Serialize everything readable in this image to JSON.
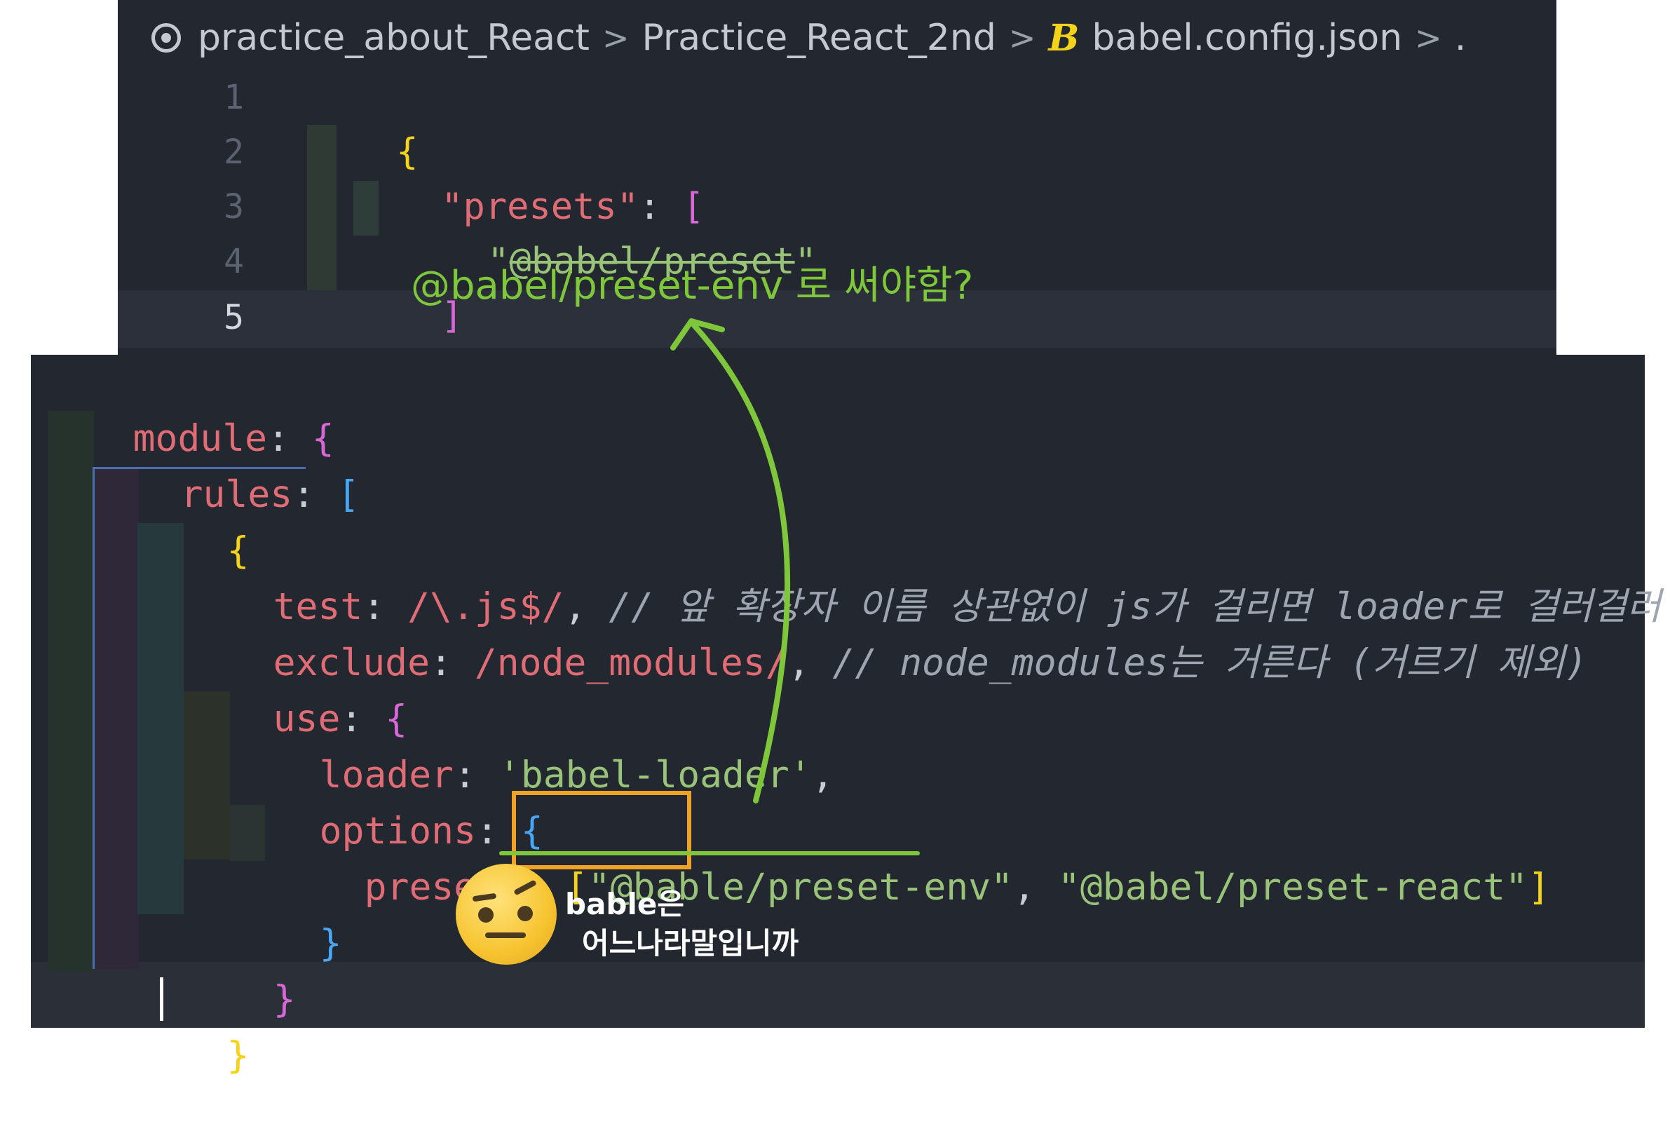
{
  "breadcrumb": {
    "items": [
      "practice_about_React",
      "Practice_React_2nd",
      "babel.config.json"
    ],
    "separator": ">",
    "trail": "."
  },
  "top_editor": {
    "line_numbers": [
      "1",
      "2",
      "3",
      "4",
      "5"
    ],
    "active_line": "5",
    "lines": {
      "l1_open": "{",
      "l2_key": "\"presets\"",
      "l2_colon": ": ",
      "l2_bracket": "[",
      "l3_q_open": "\"",
      "l3_value": "@babel/preset",
      "l3_q_close": "\"",
      "l4_bracket": "]",
      "l5_close": "}"
    }
  },
  "annotation_top": "@babel/preset-env 로 써야함?",
  "bottom_editor": {
    "module_key": "module",
    "rules_key": "rules",
    "test_key": "test",
    "test_regex": "/\\.js$/",
    "test_comment": "// 앞 확장자 이름 상관없이 js가 걸리면 loader로 걸러걸러",
    "exclude_key": "exclude",
    "exclude_regex": "/node_modules/",
    "exclude_comment": "// node_modules는 거른다 (거르기 제외)",
    "use_key": "use",
    "loader_key": "loader",
    "loader_value": "'babel-loader'",
    "options_key": "options",
    "presets_key": "presets",
    "preset_1": "\"@bable/preset-env\"",
    "preset_2": "\"@babel/preset-react\"",
    "colon": ": ",
    "comma": ","
  },
  "annotation_bottom": [
    "bable은",
    "어느나라말입니까"
  ],
  "colors": {
    "editor_bg": "#23272f",
    "annotation_green": "#7ec63a",
    "highlight_orange": "#f0a225"
  }
}
